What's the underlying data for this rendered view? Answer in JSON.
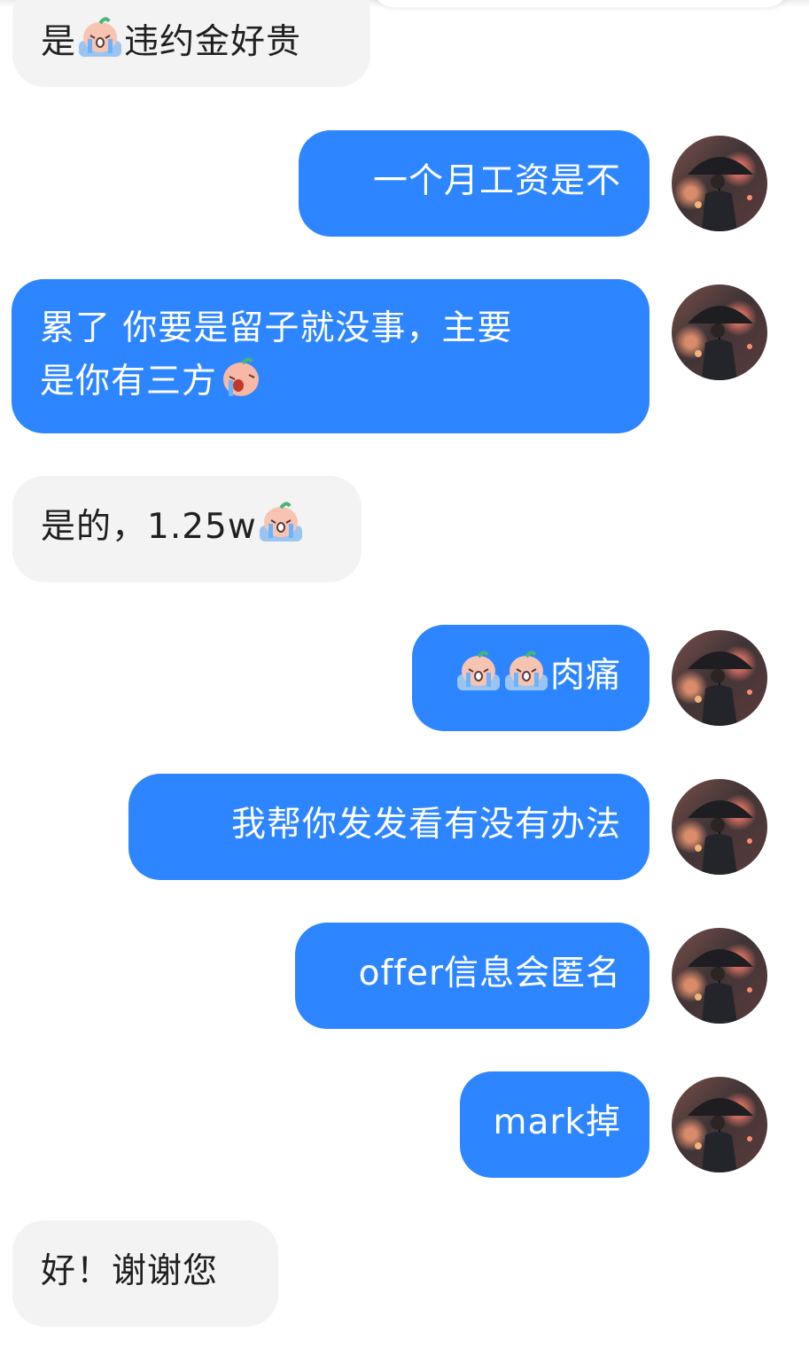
{
  "messages": [
    {
      "side": "in",
      "before": "是",
      "emoji": [
        "crying-emoji"
      ],
      "after": "违约金好贵"
    },
    {
      "side": "out",
      "text": "一个月工资是不"
    },
    {
      "side": "out",
      "line1": "累了 你要是留子就没事，主要",
      "line2": "是你有三方",
      "emoji": [
        "sobbing-emoji"
      ]
    },
    {
      "side": "in",
      "text": "是的，1.25w",
      "emoji": [
        "crying-emoji"
      ]
    },
    {
      "side": "out",
      "emoji": [
        "crying-emoji",
        "crying-emoji"
      ],
      "text": "肉痛"
    },
    {
      "side": "out",
      "text": "我帮你发发看有没有办法"
    },
    {
      "side": "out",
      "text": "offer信息会匿名"
    },
    {
      "side": "out",
      "text": "mark掉"
    },
    {
      "side": "in",
      "text": "好！谢谢您"
    }
  ],
  "colors": {
    "outgoing_bubble": "#2d86ff",
    "incoming_bubble": "#f3f3f3",
    "outgoing_text": "#ffffff",
    "incoming_text": "#1f1f1f"
  },
  "avatar_icon": "user-avatar-umbrella-man"
}
